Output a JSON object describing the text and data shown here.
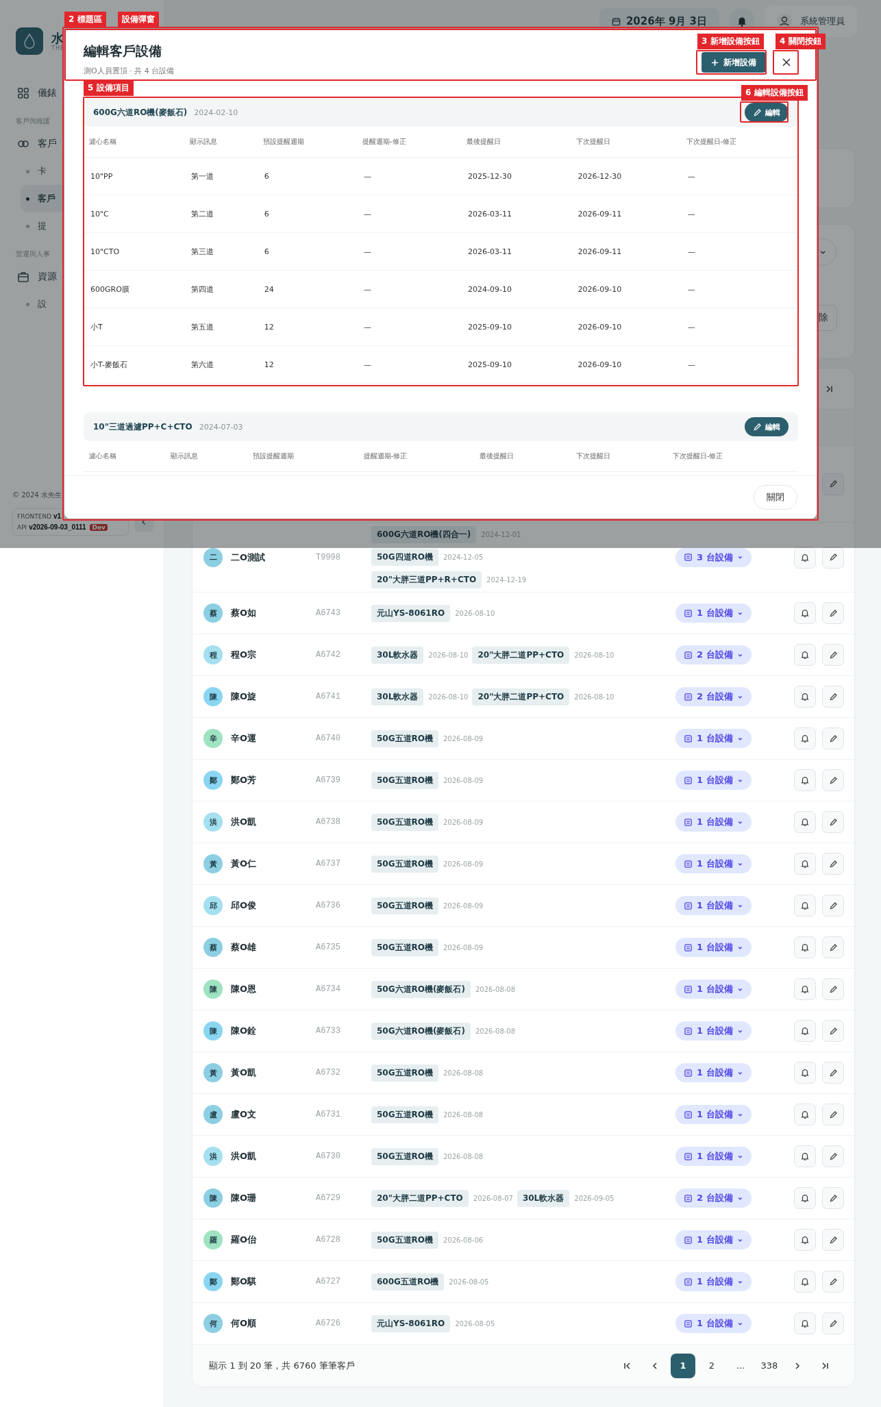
{
  "sidebar": {
    "logo_text": "水",
    "logo_subtext": "THE",
    "nav": [
      {
        "kind": "link",
        "label": "儀錶",
        "selected": false
      },
      {
        "kind": "section",
        "label": "客戶與維護"
      },
      {
        "kind": "link",
        "label": "客戶",
        "selected": false,
        "children": [
          {
            "label": "卡",
            "selected": false
          },
          {
            "label": "客戶",
            "selected": true
          },
          {
            "label": "提",
            "selected": false
          }
        ]
      },
      {
        "kind": "section",
        "label": "營運與人事"
      },
      {
        "kind": "link",
        "label": "資源",
        "selected": false,
        "children": [
          {
            "label": "設",
            "selected": false
          }
        ]
      }
    ],
    "copyright": "© 2024 水先生",
    "build": {
      "frontend_label": "FRONTEND",
      "frontend_version": "v1",
      "api_label": "API",
      "api_version": "v2026-09-03_0111",
      "env_badge": "Dev"
    }
  },
  "topbar": {
    "date": "2026年 9月 3日",
    "user": "系統管理員"
  },
  "background": {
    "danger_button": "除"
  },
  "customers": {
    "rows": [
      {
        "avatar": "二",
        "color": "#8ccfe3",
        "name": "二O測試",
        "code": "T9998",
        "devices": [
          {
            "name": "600G六道RO機(四合一)",
            "date": "2024-12-01"
          },
          {
            "name": "50G四道RO機",
            "date": "2024-12-05"
          },
          {
            "name": "20\"大胖三道PP+R+CTO",
            "date": "2024-12-19"
          }
        ],
        "device_count": "3 台設備"
      },
      {
        "avatar": "蔡",
        "color": "#8ccfe3",
        "name": "蔡O如",
        "code": "A6743",
        "devices": [
          {
            "name": "元山YS-8061RO",
            "date": "2026-08-10"
          }
        ],
        "device_count": "1 台設備"
      },
      {
        "avatar": "程",
        "color": "#a5e0f0",
        "name": "程O宗",
        "code": "A6742",
        "devices": [
          {
            "name": "30L軟水器",
            "date": "2026-08-10"
          },
          {
            "name": "20\"大胖二道PP+CTO",
            "date": "2026-08-10"
          }
        ],
        "device_count": "2 台設備"
      },
      {
        "avatar": "陳",
        "color": "#8ad6f2",
        "name": "陳O旋",
        "code": "A6741",
        "devices": [
          {
            "name": "30L軟水器",
            "date": "2026-08-10"
          },
          {
            "name": "20\"大胖二道PP+CTO",
            "date": "2026-08-10"
          }
        ],
        "device_count": "2 台設備"
      },
      {
        "avatar": "辛",
        "color": "#9fe3c2",
        "name": "辛O運",
        "code": "A6740",
        "devices": [
          {
            "name": "50G五道RO機",
            "date": "2026-08-09"
          }
        ],
        "device_count": "1 台設備"
      },
      {
        "avatar": "鄭",
        "color": "#8ad6f2",
        "name": "鄭O芳",
        "code": "A6739",
        "devices": [
          {
            "name": "50G五道RO機",
            "date": "2026-08-09"
          }
        ],
        "device_count": "1 台設備"
      },
      {
        "avatar": "洪",
        "color": "#a5e0f0",
        "name": "洪O凱",
        "code": "A6738",
        "devices": [
          {
            "name": "50G五道RO機",
            "date": "2026-08-09"
          }
        ],
        "device_count": "1 台設備"
      },
      {
        "avatar": "黃",
        "color": "#8ccfe3",
        "name": "黃O仁",
        "code": "A6737",
        "devices": [
          {
            "name": "50G五道RO機",
            "date": "2026-08-09"
          }
        ],
        "device_count": "1 台設備"
      },
      {
        "avatar": "邱",
        "color": "#a5e0f0",
        "name": "邱O俊",
        "code": "A6736",
        "devices": [
          {
            "name": "50G五道RO機",
            "date": "2026-08-09"
          }
        ],
        "device_count": "1 台設備"
      },
      {
        "avatar": "蔡",
        "color": "#8ccfe3",
        "name": "蔡O雄",
        "code": "A6735",
        "devices": [
          {
            "name": "50G五道RO機",
            "date": "2026-08-09"
          }
        ],
        "device_count": "1 台設備"
      },
      {
        "avatar": "陳",
        "color": "#9fe3c2",
        "name": "陳O恩",
        "code": "A6734",
        "devices": [
          {
            "name": "50G六道RO機(麥飯石)",
            "date": "2026-08-08"
          }
        ],
        "device_count": "1 台設備"
      },
      {
        "avatar": "陳",
        "color": "#8ad6f2",
        "name": "陳O銓",
        "code": "A6733",
        "devices": [
          {
            "name": "50G六道RO機(麥飯石)",
            "date": "2026-08-08"
          }
        ],
        "device_count": "1 台設備"
      },
      {
        "avatar": "黃",
        "color": "#8ccfe3",
        "name": "黃O凱",
        "code": "A6732",
        "devices": [
          {
            "name": "50G五道RO機",
            "date": "2026-08-08"
          }
        ],
        "device_count": "1 台設備"
      },
      {
        "avatar": "盧",
        "color": "#8ccfe3",
        "name": "盧O文",
        "code": "A6731",
        "devices": [
          {
            "name": "50G五道RO機",
            "date": "2026-08-08"
          }
        ],
        "device_count": "1 台設備"
      },
      {
        "avatar": "洪",
        "color": "#a5e0f0",
        "name": "洪O凱",
        "code": "A6730",
        "devices": [
          {
            "name": "50G五道RO機",
            "date": "2026-08-08"
          }
        ],
        "device_count": "1 台設備"
      },
      {
        "avatar": "陳",
        "color": "#8ccfe3",
        "name": "陳O珊",
        "code": "A6729",
        "devices": [
          {
            "name": "20\"大胖二道PP+CTO",
            "date": "2026-08-07"
          },
          {
            "name": "30L軟水器",
            "date": "2026-09-05"
          }
        ],
        "device_count": "2 台設備"
      },
      {
        "avatar": "羅",
        "color": "#9fe3c2",
        "name": "羅O佁",
        "code": "A6728",
        "devices": [
          {
            "name": "50G五道RO機",
            "date": "2026-08-06"
          }
        ],
        "device_count": "1 台設備"
      },
      {
        "avatar": "鄭",
        "color": "#8ad6f2",
        "name": "鄭O騏",
        "code": "A6727",
        "devices": [
          {
            "name": "600G五道RO機",
            "date": "2026-08-05"
          }
        ],
        "device_count": "1 台設備"
      },
      {
        "avatar": "何",
        "color": "#8ccfe3",
        "name": "何O順",
        "code": "A6726",
        "devices": [
          {
            "name": "元山YS-8061RO",
            "date": "2026-08-05"
          }
        ],
        "device_count": "1 台設備"
      }
    ],
    "summary": "顯示 1 到 20 筆，共 6760 筆筆客戶",
    "pagination": [
      {
        "label": "1",
        "selected": true
      },
      {
        "label": "2",
        "selected": false
      },
      {
        "label": "...",
        "selected": false
      },
      {
        "label": "338",
        "selected": false
      }
    ]
  },
  "modal": {
    "title": "編輯客戶設備",
    "subtitle": "測O人員置頂 · 共 4 台設備",
    "add_button": "新增設備",
    "close_button": "關閉",
    "devices": [
      {
        "name": "600G六道RO機(麥飯石)",
        "date": "2024-02-10",
        "edit_button": "編輯",
        "columns": [
          "濾心名稱",
          "顯示訊息",
          "預設提醒週期",
          "提醒週期-修正",
          "最後提醒日",
          "下次提醒日",
          "下次提醒日-修正"
        ],
        "rows": [
          [
            "10\"PP",
            "第一道",
            "6",
            "—",
            "2025-12-30",
            "2026-12-30",
            "—"
          ],
          [
            "10\"C",
            "第二道",
            "6",
            "—",
            "2026-03-11",
            "2026-09-11",
            "—"
          ],
          [
            "10\"CTO",
            "第三道",
            "6",
            "—",
            "2026-03-11",
            "2026-09-11",
            "—"
          ],
          [
            "600GRO膜",
            "第四道",
            "24",
            "—",
            "2024-09-10",
            "2026-09-10",
            "—"
          ],
          [
            "小T",
            "第五道",
            "12",
            "—",
            "2025-09-10",
            "2026-09-10",
            "—"
          ],
          [
            "小T-麥飯石",
            "第六道",
            "12",
            "—",
            "2025-09-10",
            "2026-09-10",
            "—"
          ]
        ]
      },
      {
        "name": "10\"三道過濾PP+C+CTO",
        "date": "2024-07-03",
        "edit_button": "編輯",
        "columns": [
          "濾心名稱",
          "顯示訊息",
          "預設提醒週期",
          "提醒週期-修正",
          "最後提醒日",
          "下次提醒日",
          "下次提醒日-修正"
        ]
      }
    ]
  },
  "annotations": [
    {
      "label": "2 標題區"
    },
    {
      "label": "設備彈窗"
    },
    {
      "label": "3 新增設備按鈕"
    },
    {
      "label": "4 關閉按鈕"
    },
    {
      "label": "5 設備項目"
    },
    {
      "label": "6 編輯設備按鈕"
    }
  ]
}
